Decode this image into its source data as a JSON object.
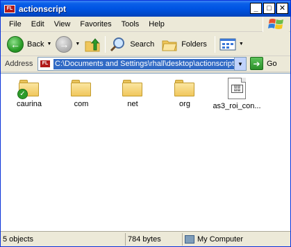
{
  "window": {
    "title": "actionscript"
  },
  "title_buttons": {
    "minimize": "_",
    "maximize": "□",
    "close": "✕"
  },
  "menu": [
    "File",
    "Edit",
    "View",
    "Favorites",
    "Tools",
    "Help"
  ],
  "toolbar": {
    "back_label": "Back",
    "search_label": "Search",
    "folders_label": "Folders"
  },
  "address": {
    "label": "Address",
    "value": "C:\\Documents and Settings\\rhall\\desktop\\actionscript",
    "go_label": "Go"
  },
  "items": [
    {
      "name": "caurina",
      "type": "folder",
      "badge": "check"
    },
    {
      "name": "com",
      "type": "folder"
    },
    {
      "name": "net",
      "type": "folder"
    },
    {
      "name": "org",
      "type": "folder"
    },
    {
      "name": "as3_roi_con...",
      "type": "file"
    }
  ],
  "status": {
    "objects": "5 objects",
    "size": "784 bytes",
    "location": "My Computer"
  },
  "colors": {
    "titlebar": "#0054e3",
    "selection": "#316ac5",
    "folder": "#f0c75c",
    "frame": "#ece9d8"
  }
}
